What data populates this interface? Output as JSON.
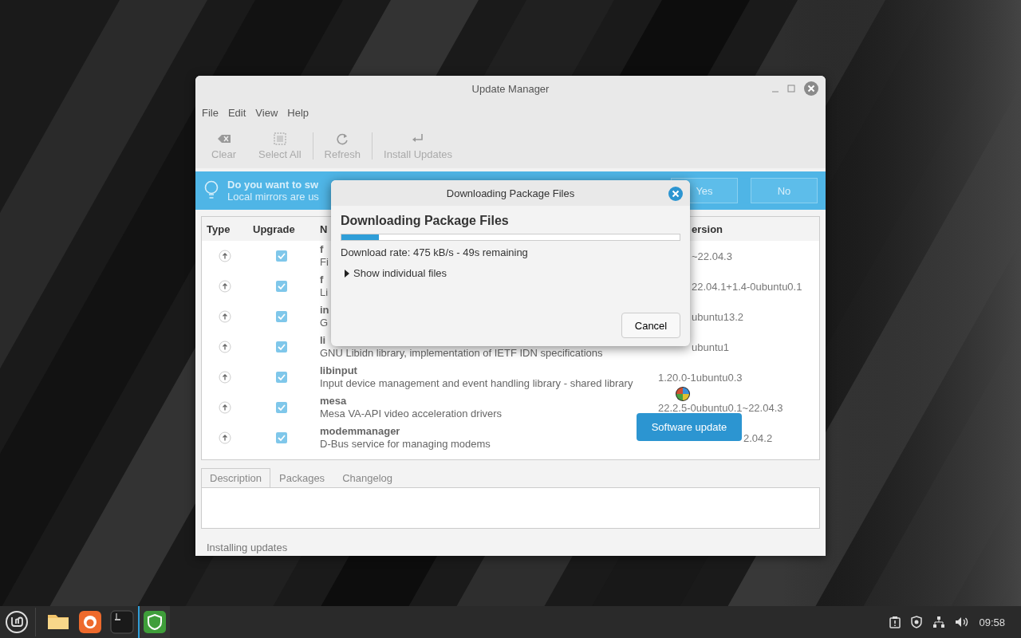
{
  "window": {
    "title": "Update Manager"
  },
  "menu": [
    "File",
    "Edit",
    "View",
    "Help"
  ],
  "toolbar": [
    {
      "kind": "clear",
      "label": "Clear",
      "disabled": true
    },
    {
      "kind": "select",
      "label": "Select All",
      "disabled": true
    },
    {
      "kind": "refresh",
      "label": "Refresh",
      "disabled": true
    },
    {
      "kind": "install",
      "label": "Install Updates",
      "disabled": true
    }
  ],
  "banner": {
    "title": "Do you want to sw",
    "text": "Local mirrors are us",
    "buttons": [
      "Yes",
      "No"
    ]
  },
  "table": {
    "columns": [
      "Type",
      "Upgrade",
      "N",
      "ersion"
    ],
    "rows": [
      {
        "name": "f",
        "description": "Fi",
        "version": "~22.04.3",
        "checked": true
      },
      {
        "name": "f",
        "description": "Li",
        "version": "22.04.1+1.4-0ubuntu0.1",
        "checked": true
      },
      {
        "name": "in",
        "description": "G",
        "version": "ubuntu13.2",
        "checked": true
      },
      {
        "name": "li",
        "description": "GNU Libidn library, implementation of IETF IDN specifications",
        "version": "ubuntu1",
        "checked": true
      },
      {
        "name": "libinput",
        "description": "Input device management and event handling library - shared library",
        "version": "1.20.0-1ubuntu0.3",
        "checked": true
      },
      {
        "name": "mesa",
        "description": "Mesa VA-API video acceleration drivers",
        "version": "22.2.5-0ubuntu0.1~22.04.3",
        "checked": true
      },
      {
        "name": "modemmanager",
        "description": "D-Bus service for managing modems",
        "version": "2.04.2",
        "checked": true
      }
    ]
  },
  "tabs": [
    {
      "label": "Description",
      "selected": true
    },
    {
      "label": "Packages",
      "selected": false
    },
    {
      "label": "Changelog",
      "selected": false
    }
  ],
  "status_bar": "Installing updates",
  "dialog": {
    "title": "Downloading Package Files",
    "heading": "Downloading Package Files",
    "level": 0.11,
    "rate": "Download rate: 475 kB/s - 49s remaining",
    "expander": {
      "label": "Show individual files",
      "expanded": false
    },
    "button": "Cancel"
  },
  "notification": "Software update",
  "taskbar": {
    "apps": [
      {
        "kind": "files",
        "active": false
      },
      {
        "kind": "browser",
        "active": false
      },
      {
        "kind": "terminal",
        "active": false
      },
      {
        "kind": "shield",
        "active": true
      }
    ],
    "clock": "09:58"
  }
}
